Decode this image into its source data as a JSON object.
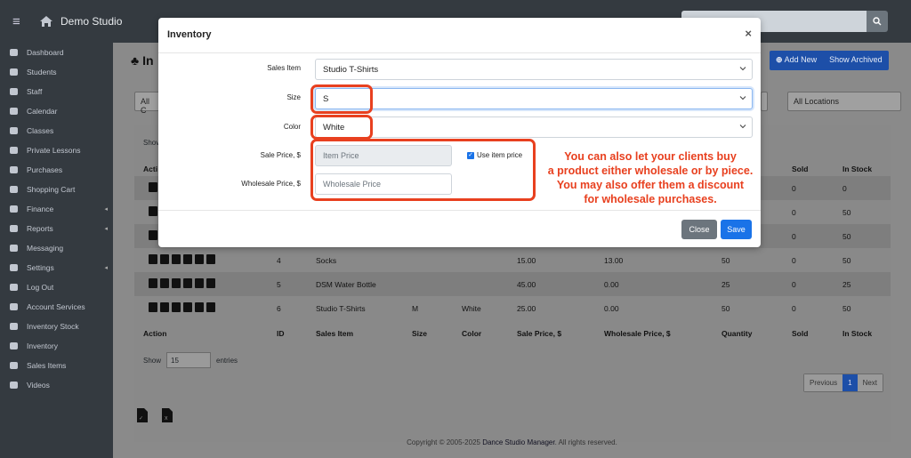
{
  "app": {
    "brand": "Demo Studio"
  },
  "sidebar": {
    "items": [
      {
        "label": "Dashboard",
        "icon": "dashboard-icon",
        "caret": false
      },
      {
        "label": "Students",
        "icon": "students-icon",
        "caret": false
      },
      {
        "label": "Staff",
        "icon": "staff-icon",
        "caret": false
      },
      {
        "label": "Calendar",
        "icon": "calendar-icon",
        "caret": false
      },
      {
        "label": "Classes",
        "icon": "classes-icon",
        "caret": false
      },
      {
        "label": "Private Lessons",
        "icon": "private-lessons-icon",
        "caret": false
      },
      {
        "label": "Purchases",
        "icon": "purchases-icon",
        "caret": false
      },
      {
        "label": "Shopping Cart",
        "icon": "cart-icon",
        "caret": false
      },
      {
        "label": "Finance",
        "icon": "dollar-icon",
        "caret": true
      },
      {
        "label": "Reports",
        "icon": "reports-icon",
        "caret": true
      },
      {
        "label": "Messaging",
        "icon": "envelope-icon",
        "caret": false
      },
      {
        "label": "Settings",
        "icon": "gear-icon",
        "caret": true
      },
      {
        "label": "Log Out",
        "icon": "logout-icon",
        "caret": false
      },
      {
        "label": "Account Services",
        "icon": "cloud-icon",
        "caret": false
      },
      {
        "label": "Inventory Stock",
        "icon": "stack-icon",
        "caret": false
      },
      {
        "label": "Inventory",
        "icon": "inventory-icon",
        "caret": false
      },
      {
        "label": "Sales Items",
        "icon": "sales-items-icon",
        "caret": false
      },
      {
        "label": "Videos",
        "icon": "video-icon",
        "caret": false
      }
    ]
  },
  "page": {
    "title": "In",
    "add_new": "Add New",
    "show_archived": "Show Archived",
    "filter_left": "All C",
    "filter_locations": "All Locations",
    "show_top": "Shov",
    "show_label": "Show",
    "show_value": "15",
    "entries_label": "entries"
  },
  "table": {
    "columns": [
      "Action",
      "ID",
      "Sales Item",
      "Size",
      "Color",
      "Sale Price, $",
      "Wholesale Price, $",
      "Quantity",
      "Sold",
      "In Stock"
    ],
    "head_partial": {
      "action": "Acti",
      "sold": "Sold",
      "in_stock": "In Stock"
    },
    "hidden_rows": [
      {
        "sold": "0",
        "in_stock": "0"
      },
      {
        "sold": "0",
        "in_stock": "50"
      },
      {
        "sold": "0",
        "in_stock": "50"
      }
    ],
    "rows": [
      {
        "id": "4",
        "item": "Socks",
        "size": "",
        "color": "",
        "sale": "15.00",
        "wholesale": "13.00",
        "qty": "50",
        "sold": "0",
        "stock": "50"
      },
      {
        "id": "5",
        "item": "DSM Water Bottle",
        "size": "",
        "color": "",
        "sale": "45.00",
        "wholesale": "0.00",
        "qty": "25",
        "sold": "0",
        "stock": "25"
      },
      {
        "id": "6",
        "item": "Studio T-Shirts",
        "size": "M",
        "color": "White",
        "sale": "25.00",
        "wholesale": "0.00",
        "qty": "50",
        "sold": "0",
        "stock": "50"
      }
    ]
  },
  "pagination": {
    "previous": "Previous",
    "current": "1",
    "next": "Next"
  },
  "footer": {
    "text": "Copyright © 2005-2025 ",
    "brand": "Dance Studio Manager",
    "suffix": ". All rights reserved."
  },
  "modal": {
    "title": "Inventory",
    "close_symbol": "×",
    "sales_item_label": "Sales Item",
    "sales_item_value": "Studio T-Shirts",
    "size_label": "Size",
    "size_value": "S",
    "color_label": "Color",
    "color_value": "White",
    "sale_price_label": "Sale Price, $",
    "sale_price_placeholder": "Item Price",
    "use_item_price_label": "Use item price",
    "use_item_price_checked": true,
    "wholesale_label": "Wholesale Price, $",
    "wholesale_placeholder": "Wholesale Price",
    "close_button": "Close",
    "save_button": "Save"
  },
  "callout": {
    "line1": "You can also let your clients buy",
    "line2": "a product either wholesale or by piece.",
    "line3": "You may also offer them a discount",
    "line4": "for wholesale purchases.",
    "color": "#e8401f"
  },
  "colors": {
    "primary": "#1a73e8",
    "sidebar": "#343a40",
    "secondary": "#6c757d"
  }
}
